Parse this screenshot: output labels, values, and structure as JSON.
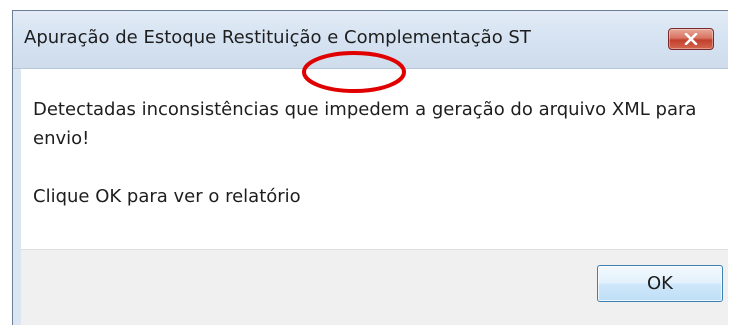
{
  "dialog": {
    "title": "Apuração de Estoque Restituição e Complementação ST",
    "close_icon": "close-icon",
    "message_line1": "Detectadas inconsistências que impedem a geração do arquivo XML para envio!",
    "message_line2": "Clique OK para ver o relatório",
    "ok_label": "OK"
  },
  "annotation": {
    "shape": "ellipse",
    "color": "#e00000"
  }
}
